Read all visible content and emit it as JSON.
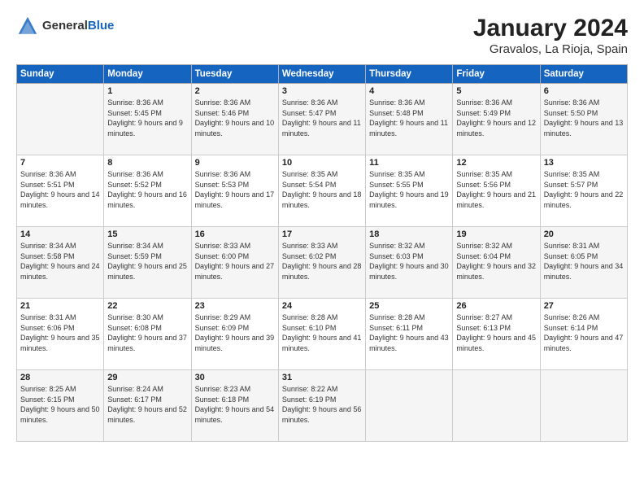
{
  "logo": {
    "text_general": "General",
    "text_blue": "Blue"
  },
  "title": "January 2024",
  "subtitle": "Gravalos, La Rioja, Spain",
  "days_of_week": [
    "Sunday",
    "Monday",
    "Tuesday",
    "Wednesday",
    "Thursday",
    "Friday",
    "Saturday"
  ],
  "weeks": [
    [
      {
        "day": "",
        "sunrise": "",
        "sunset": "",
        "daylight": ""
      },
      {
        "day": "1",
        "sunrise": "Sunrise: 8:36 AM",
        "sunset": "Sunset: 5:45 PM",
        "daylight": "Daylight: 9 hours and 9 minutes."
      },
      {
        "day": "2",
        "sunrise": "Sunrise: 8:36 AM",
        "sunset": "Sunset: 5:46 PM",
        "daylight": "Daylight: 9 hours and 10 minutes."
      },
      {
        "day": "3",
        "sunrise": "Sunrise: 8:36 AM",
        "sunset": "Sunset: 5:47 PM",
        "daylight": "Daylight: 9 hours and 11 minutes."
      },
      {
        "day": "4",
        "sunrise": "Sunrise: 8:36 AM",
        "sunset": "Sunset: 5:48 PM",
        "daylight": "Daylight: 9 hours and 11 minutes."
      },
      {
        "day": "5",
        "sunrise": "Sunrise: 8:36 AM",
        "sunset": "Sunset: 5:49 PM",
        "daylight": "Daylight: 9 hours and 12 minutes."
      },
      {
        "day": "6",
        "sunrise": "Sunrise: 8:36 AM",
        "sunset": "Sunset: 5:50 PM",
        "daylight": "Daylight: 9 hours and 13 minutes."
      }
    ],
    [
      {
        "day": "7",
        "sunrise": "Sunrise: 8:36 AM",
        "sunset": "Sunset: 5:51 PM",
        "daylight": "Daylight: 9 hours and 14 minutes."
      },
      {
        "day": "8",
        "sunrise": "Sunrise: 8:36 AM",
        "sunset": "Sunset: 5:52 PM",
        "daylight": "Daylight: 9 hours and 16 minutes."
      },
      {
        "day": "9",
        "sunrise": "Sunrise: 8:36 AM",
        "sunset": "Sunset: 5:53 PM",
        "daylight": "Daylight: 9 hours and 17 minutes."
      },
      {
        "day": "10",
        "sunrise": "Sunrise: 8:35 AM",
        "sunset": "Sunset: 5:54 PM",
        "daylight": "Daylight: 9 hours and 18 minutes."
      },
      {
        "day": "11",
        "sunrise": "Sunrise: 8:35 AM",
        "sunset": "Sunset: 5:55 PM",
        "daylight": "Daylight: 9 hours and 19 minutes."
      },
      {
        "day": "12",
        "sunrise": "Sunrise: 8:35 AM",
        "sunset": "Sunset: 5:56 PM",
        "daylight": "Daylight: 9 hours and 21 minutes."
      },
      {
        "day": "13",
        "sunrise": "Sunrise: 8:35 AM",
        "sunset": "Sunset: 5:57 PM",
        "daylight": "Daylight: 9 hours and 22 minutes."
      }
    ],
    [
      {
        "day": "14",
        "sunrise": "Sunrise: 8:34 AM",
        "sunset": "Sunset: 5:58 PM",
        "daylight": "Daylight: 9 hours and 24 minutes."
      },
      {
        "day": "15",
        "sunrise": "Sunrise: 8:34 AM",
        "sunset": "Sunset: 5:59 PM",
        "daylight": "Daylight: 9 hours and 25 minutes."
      },
      {
        "day": "16",
        "sunrise": "Sunrise: 8:33 AM",
        "sunset": "Sunset: 6:00 PM",
        "daylight": "Daylight: 9 hours and 27 minutes."
      },
      {
        "day": "17",
        "sunrise": "Sunrise: 8:33 AM",
        "sunset": "Sunset: 6:02 PM",
        "daylight": "Daylight: 9 hours and 28 minutes."
      },
      {
        "day": "18",
        "sunrise": "Sunrise: 8:32 AM",
        "sunset": "Sunset: 6:03 PM",
        "daylight": "Daylight: 9 hours and 30 minutes."
      },
      {
        "day": "19",
        "sunrise": "Sunrise: 8:32 AM",
        "sunset": "Sunset: 6:04 PM",
        "daylight": "Daylight: 9 hours and 32 minutes."
      },
      {
        "day": "20",
        "sunrise": "Sunrise: 8:31 AM",
        "sunset": "Sunset: 6:05 PM",
        "daylight": "Daylight: 9 hours and 34 minutes."
      }
    ],
    [
      {
        "day": "21",
        "sunrise": "Sunrise: 8:31 AM",
        "sunset": "Sunset: 6:06 PM",
        "daylight": "Daylight: 9 hours and 35 minutes."
      },
      {
        "day": "22",
        "sunrise": "Sunrise: 8:30 AM",
        "sunset": "Sunset: 6:08 PM",
        "daylight": "Daylight: 9 hours and 37 minutes."
      },
      {
        "day": "23",
        "sunrise": "Sunrise: 8:29 AM",
        "sunset": "Sunset: 6:09 PM",
        "daylight": "Daylight: 9 hours and 39 minutes."
      },
      {
        "day": "24",
        "sunrise": "Sunrise: 8:28 AM",
        "sunset": "Sunset: 6:10 PM",
        "daylight": "Daylight: 9 hours and 41 minutes."
      },
      {
        "day": "25",
        "sunrise": "Sunrise: 8:28 AM",
        "sunset": "Sunset: 6:11 PM",
        "daylight": "Daylight: 9 hours and 43 minutes."
      },
      {
        "day": "26",
        "sunrise": "Sunrise: 8:27 AM",
        "sunset": "Sunset: 6:13 PM",
        "daylight": "Daylight: 9 hours and 45 minutes."
      },
      {
        "day": "27",
        "sunrise": "Sunrise: 8:26 AM",
        "sunset": "Sunset: 6:14 PM",
        "daylight": "Daylight: 9 hours and 47 minutes."
      }
    ],
    [
      {
        "day": "28",
        "sunrise": "Sunrise: 8:25 AM",
        "sunset": "Sunset: 6:15 PM",
        "daylight": "Daylight: 9 hours and 50 minutes."
      },
      {
        "day": "29",
        "sunrise": "Sunrise: 8:24 AM",
        "sunset": "Sunset: 6:17 PM",
        "daylight": "Daylight: 9 hours and 52 minutes."
      },
      {
        "day": "30",
        "sunrise": "Sunrise: 8:23 AM",
        "sunset": "Sunset: 6:18 PM",
        "daylight": "Daylight: 9 hours and 54 minutes."
      },
      {
        "day": "31",
        "sunrise": "Sunrise: 8:22 AM",
        "sunset": "Sunset: 6:19 PM",
        "daylight": "Daylight: 9 hours and 56 minutes."
      },
      {
        "day": "",
        "sunrise": "",
        "sunset": "",
        "daylight": ""
      },
      {
        "day": "",
        "sunrise": "",
        "sunset": "",
        "daylight": ""
      },
      {
        "day": "",
        "sunrise": "",
        "sunset": "",
        "daylight": ""
      }
    ]
  ]
}
